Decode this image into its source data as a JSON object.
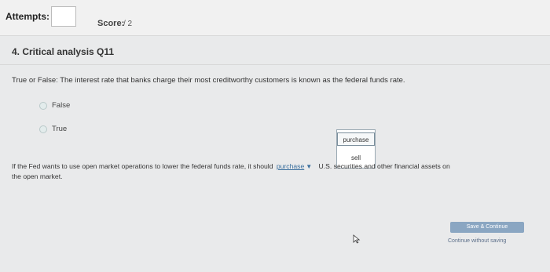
{
  "header": {
    "attempts_label": "Attempts:",
    "attempts_value": "",
    "score_label": "Score:",
    "score_value": "/ 2"
  },
  "question": {
    "title": "4. Critical analysis Q11",
    "statement": "True or False: The interest rate that banks charge their most creditworthy customers is known as the federal funds rate.",
    "options": [
      {
        "label": "False",
        "selected": false
      },
      {
        "label": "True",
        "selected": false
      }
    ]
  },
  "fill_in": {
    "before": "If the Fed wants to use open market operations to lower the federal funds rate, it should",
    "selected_value": "purchase",
    "after": "U.S. securities and other financial assets on",
    "line2": "the open market.",
    "dropdown_options": [
      "purchase",
      "sell"
    ]
  },
  "actions": {
    "save_label": "Save & Continue",
    "continue_label": "Continue without saving"
  }
}
